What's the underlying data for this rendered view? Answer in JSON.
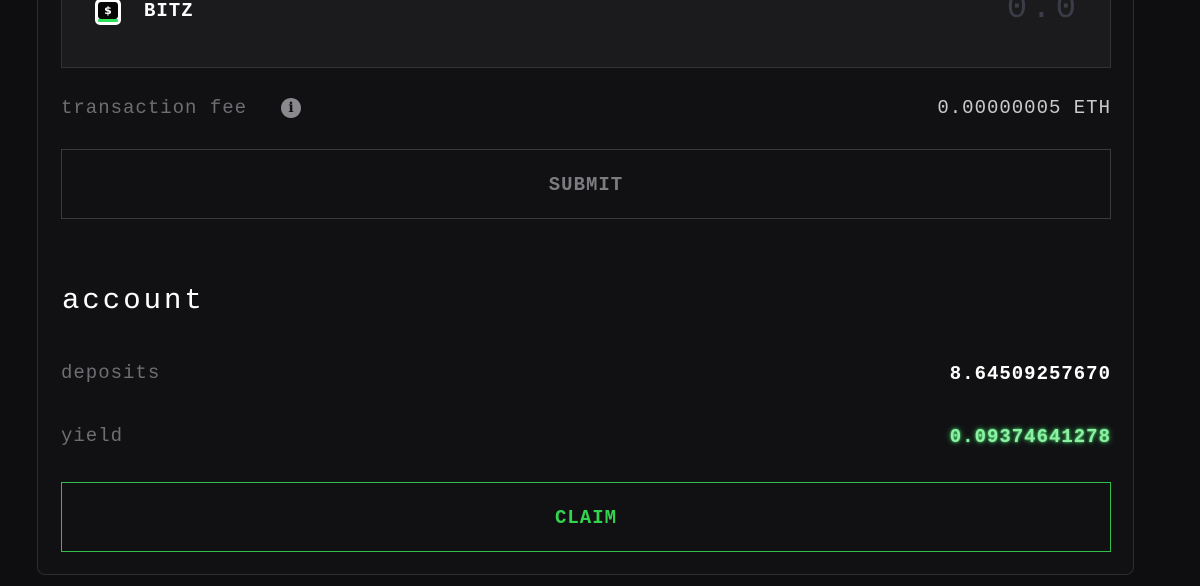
{
  "token": {
    "icon": "dollar-token-icon",
    "icon_glyph": "$",
    "name": "BITZ",
    "amount": "0.0"
  },
  "fee": {
    "label": "transaction fee",
    "info_icon": "info-icon",
    "info_glyph": "i",
    "value": "0.00000005 ETH"
  },
  "submit": {
    "label": "SUBMIT"
  },
  "account": {
    "title": "account",
    "deposits_label": "deposits",
    "deposits_value": "8.64509257670",
    "yield_label": "yield",
    "yield_value": "0.09374641278",
    "claim_label": "CLAIM"
  },
  "colors": {
    "background": "#0e0e10",
    "panel": "#111113",
    "accent_green": "#33d34f",
    "yield_green": "#8ef0a3",
    "muted_text": "#6e6e72"
  }
}
